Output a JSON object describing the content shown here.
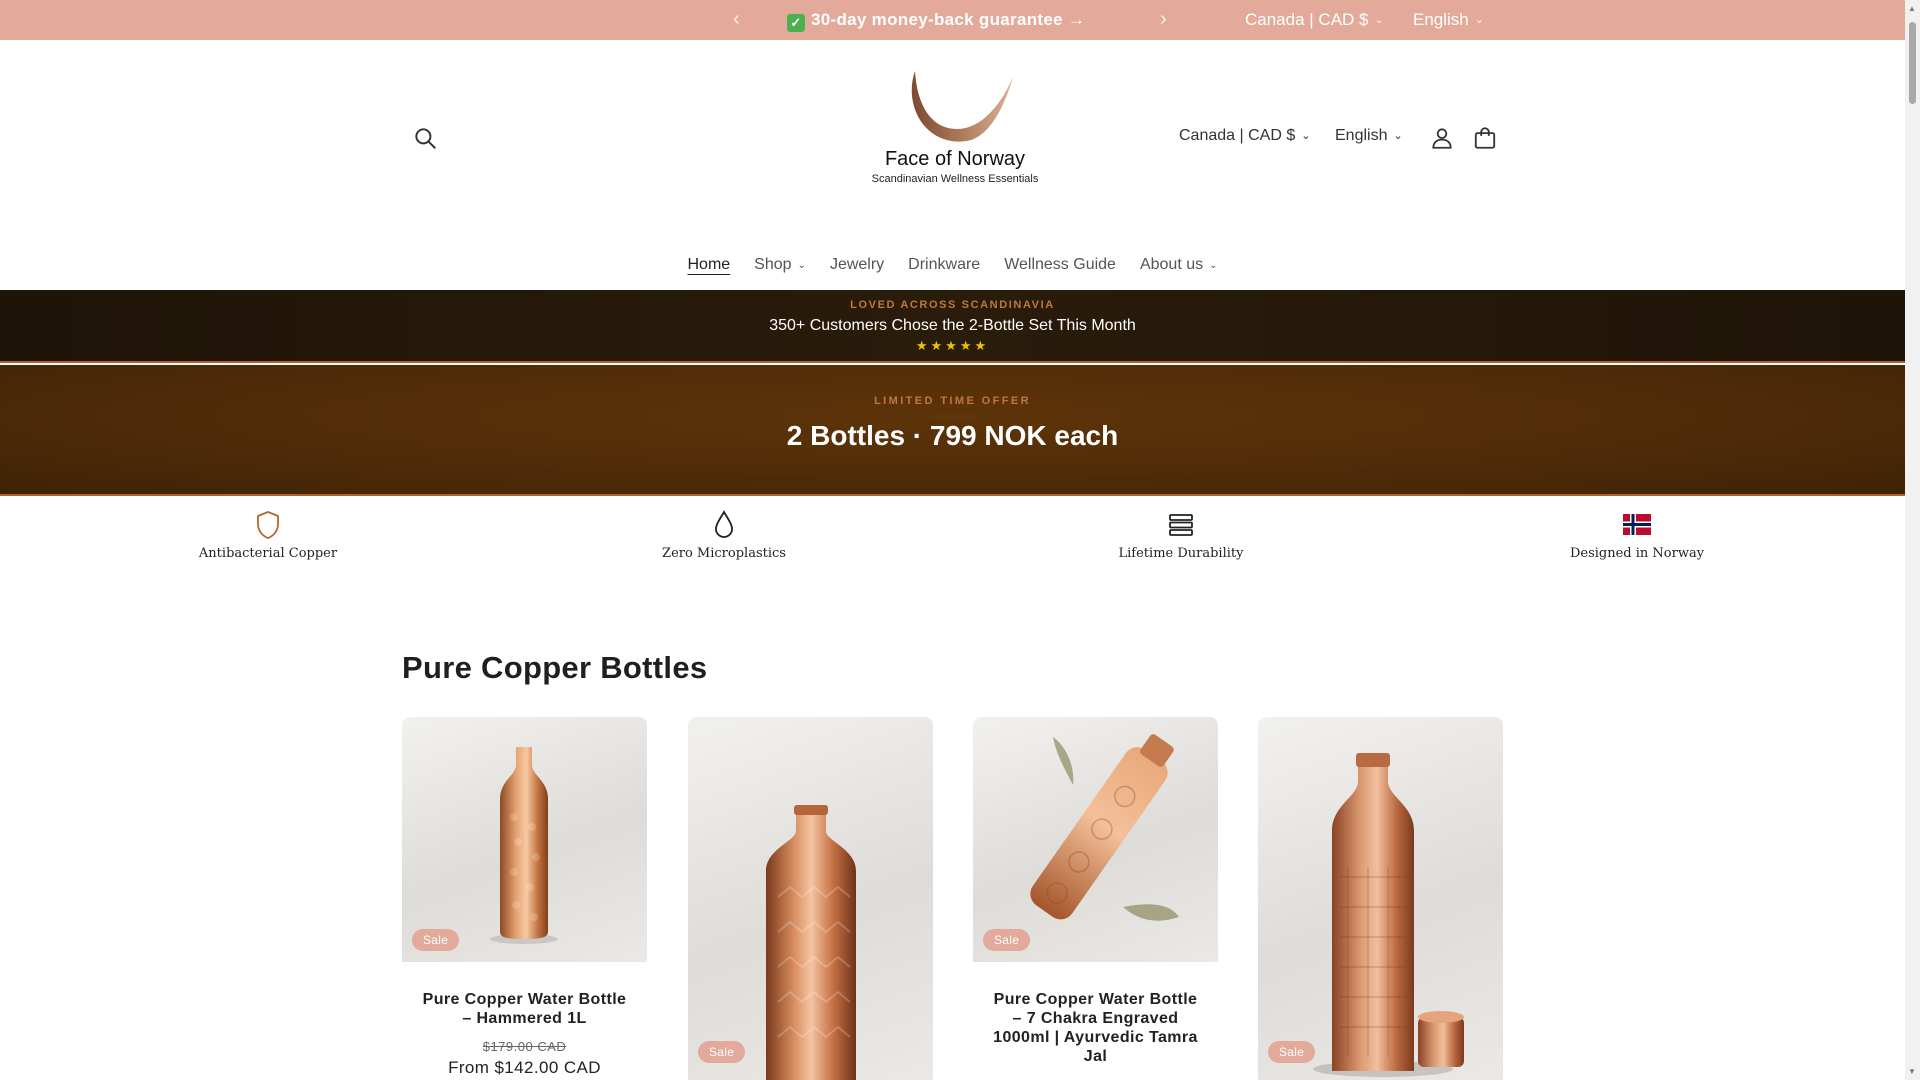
{
  "announcement": {
    "message": "30-day money-back guarantee →",
    "check_icon": "check-mark-icon",
    "prev_icon": "chevron-left-icon",
    "next_icon": "chevron-right-icon",
    "currency": "Canada | CAD $",
    "language": "English",
    "background": "#e3a99a"
  },
  "header": {
    "brand": "Face of Norway",
    "tagline": "Scandinavian Wellness Essentials",
    "currency": "Canada | CAD $",
    "language": "English",
    "icons": [
      "search-icon",
      "account-icon",
      "cart-icon"
    ]
  },
  "nav": {
    "items": [
      {
        "label": "Home",
        "active": true,
        "dropdown": false
      },
      {
        "label": "Shop",
        "active": false,
        "dropdown": true
      },
      {
        "label": "Jewelry",
        "active": false,
        "dropdown": false
      },
      {
        "label": "Drinkware",
        "active": false,
        "dropdown": false
      },
      {
        "label": "Wellness Guide",
        "active": false,
        "dropdown": false
      },
      {
        "label": "About us",
        "active": false,
        "dropdown": true
      }
    ]
  },
  "social_proof": {
    "kicker": "LOVED ACROSS SCANDINAVIA",
    "headline": "350+ Customers Chose the 2-Bottle Set This Month",
    "stars": "★★★★★",
    "rating": 5
  },
  "offer": {
    "kicker": "LIMITED TIME OFFER",
    "headline": "2 Bottles · 799 NOK each"
  },
  "features": [
    {
      "label": "Antibacterial Copper",
      "icon": "shield-icon"
    },
    {
      "label": "Zero Microplastics",
      "icon": "water-drop-icon"
    },
    {
      "label": "Lifetime Durability",
      "icon": "layers-icon"
    },
    {
      "label": "Designed in Norway",
      "icon": "norway-flag-icon"
    }
  ],
  "collection": {
    "title": "Pure Copper Bottles",
    "products": [
      {
        "name": "Pure Copper Water Bottle – Hammered 1L",
        "badge": "Sale",
        "compare_price": "$179.00 CAD",
        "price": "From $142.00 CAD"
      },
      {
        "name": "",
        "badge": "Sale",
        "compare_price": "",
        "price": ""
      },
      {
        "name": "Pure Copper Water Bottle – 7 Chakra Engraved 1000ml | Ayurvedic Tamra Jal",
        "badge": "Sale",
        "compare_price": "",
        "price": ""
      },
      {
        "name": "",
        "badge": "Sale",
        "compare_price": "",
        "price": ""
      }
    ]
  },
  "colors": {
    "accent": "#e3a99a",
    "copper": "#c2763c",
    "dark_banner": "#2a1c0b",
    "offer_banner": "#5e3409"
  }
}
